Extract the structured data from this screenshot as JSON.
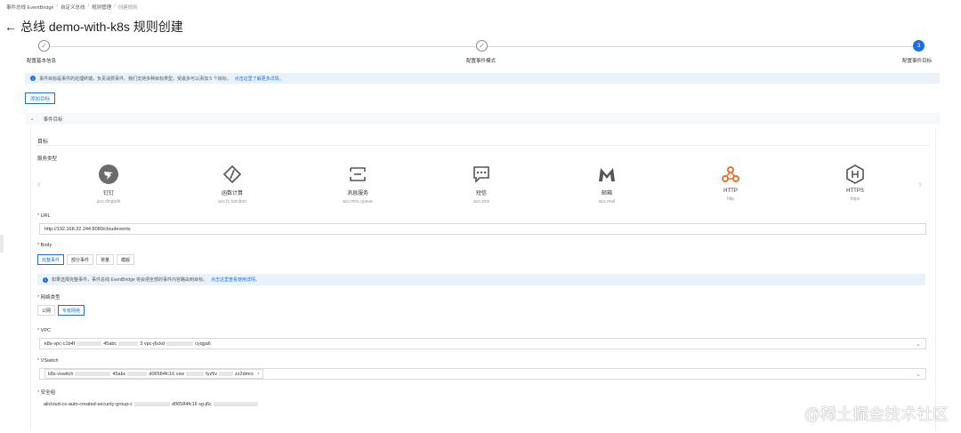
{
  "breadcrumb": [
    "事件总线 EventBridge",
    "自定义总线",
    "规则管理",
    "创建规则"
  ],
  "page_title": "总线 demo-with-k8s 规则创建",
  "steps": [
    {
      "label": "配置基本信息",
      "state": "done"
    },
    {
      "label": "配置事件模式",
      "state": "done"
    },
    {
      "label": "配置事件目标",
      "state": "active",
      "index": "3"
    }
  ],
  "info_bar": {
    "text": "事件目标是事件的处理终端，负责消费事件。我们支持多种目标类型，受最多可以添加 5 个目标。",
    "link": "点击这里了解更多详情。"
  },
  "add_target_label": "添加目标",
  "panel_title": "事件目标",
  "section_title": "目标",
  "service_type_label": "服务类型",
  "services": [
    {
      "name": "钉钉",
      "code": "acs.dingtalk",
      "icon": "dingtalk-icon"
    },
    {
      "name": "函数计算",
      "code": "acs.fc.function",
      "icon": "function-compute-icon"
    },
    {
      "name": "消息服务",
      "code": "acs.mns.queue",
      "icon": "message-service-icon"
    },
    {
      "name": "短信",
      "code": "acs.sms",
      "icon": "sms-icon"
    },
    {
      "name": "邮箱",
      "code": "acs.mail",
      "icon": "mail-icon"
    },
    {
      "name": "HTTP",
      "code": "http",
      "icon": "webhook-icon"
    },
    {
      "name": "HTTPS",
      "code": "https",
      "icon": "https-icon"
    }
  ],
  "url": {
    "label": "URL",
    "value": "http://192.168.32.244:8080/cloudevents"
  },
  "body": {
    "label": "Body",
    "options": [
      "完整事件",
      "部分事件",
      "常量",
      "模版"
    ],
    "selected": "完整事件"
  },
  "notice": {
    "text": "如果选择完整事件，事件总线 EventBridge 将会把全部的事件内容路由到目标。",
    "link": "点击这里查看使用详情。"
  },
  "network": {
    "label": "网络类型",
    "options": [
      "公网",
      "专有网络"
    ],
    "selected": "专有网络"
  },
  "vpc": {
    "label": "VPC",
    "value_start": "k8s-vpc-c1b4f",
    "value_mid": "45abc",
    "value_tail": "3 vpc-j6ckd",
    "value_end": "cyqga6"
  },
  "vswitch": {
    "label": "VSwitch",
    "value_start": "k8s-vswitch",
    "value_mid": "45abc",
    "value_mid2": "d06584fc16 vsw",
    "value_mid3": "fyz5v",
    "value_end": "zz2dmrs"
  },
  "security_group": {
    "label": "安全组",
    "value": "alicloud-cs-auto-created-security-group-c",
    "value_mid": "d06584fc16 sg-j6c"
  },
  "watermark": "@稀土掘金技术社区",
  "colors": {
    "accent": "#1d6fe0",
    "info_bg": "#e9f2fb"
  }
}
